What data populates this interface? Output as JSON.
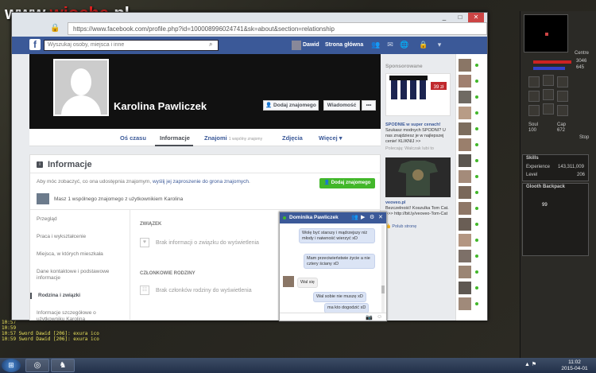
{
  "watermark": {
    "prefix": "www.",
    "brand": "wiocha",
    "suffix": ".pl"
  },
  "game": {
    "chat_log": [
      "10:57",
      "10:59",
      "10:57 Sword Dawid [206]: exura ico",
      "10:59 Sword Dawid [206]: exura ico"
    ],
    "panel": {
      "centre_label": "Centre",
      "hp": "3046",
      "mana": "645",
      "soul_label": "Soul",
      "soul_value": "100",
      "cap_label": "Cap",
      "cap_value": "672",
      "stop_label": "Stop",
      "skills_title": "Skills",
      "experience_label": "Experience",
      "experience_value": "143,311,009",
      "level_label": "Level",
      "level_value": "206",
      "backpack_title": "Glooth Backpack",
      "backpack_count": "99"
    }
  },
  "browser": {
    "url": "https://www.facebook.com/profile.php?id=100008996024741&sk=about&section=relationship"
  },
  "fb": {
    "search_placeholder": "Wyszukaj osoby, miejsca i inne",
    "user_name": "Dawid",
    "home_label": "Strona główna",
    "profile_name": "Karolina Pawliczek",
    "add_friend": "Dodaj znajomego",
    "message": "Wiadomość",
    "more": "•••",
    "tabs": {
      "timeline": "Oś czasu",
      "about": "Informacje",
      "friends": "Znajomi",
      "friends_sub": "1 wspólny znajomy",
      "photos": "Zdjęcia",
      "more": "Więcej"
    },
    "about": {
      "title": "Informacje",
      "invite_pre": "Aby móc zobaczyć, co ona udostępnia znajomym,",
      "invite_link": "wyślij jej zaproszenie do grona znajomych",
      "invite_post": ".",
      "add_btn": "Dodaj znajomego",
      "mutual": "Masz 1 wspólnego znajomego z użytkownikiem Karolina",
      "menu": [
        "Przegląd",
        "Praca i wykształcenie",
        "Miejsca, w których mieszkała",
        "Dane kontaktowe i podstawowe informacje",
        "Rodzina i związki",
        "Informacje szczegółowe o użytkowniku Karolina"
      ],
      "section1_title": "ZWIĄZEK",
      "section1_text": "Brak informacji o związku do wyświetlenia",
      "section2_title": "CZŁONKOWIE RODZINY",
      "section2_text": "Brak członków rodziny do wyświetlenia"
    },
    "sponsored": {
      "title": "Sponsorowane",
      "ad1_price": "39 zł",
      "ad1_head": "SPODNIE w super cenach!",
      "ad1_body": "Szukasz modnych SPODNI? U nas znajdziesz je w najlepszej cenie! KLIKNIJ >>",
      "ad1_sub": "Polecają: Walczak lubi to",
      "ad2_domain": "veoveo.pl",
      "ad2_body": "Bezczelność! Koszulka Tom Cat. >>> http://bit.ly/veoveo-Tom-Cat",
      "ad2_like": "Polub stronę"
    },
    "chat": {
      "name": "Dominika Pawliczek",
      "messages": [
        {
          "dir": "out",
          "text": "Wolę być starszy i mądrzejszy niż młody i naiwność wierzyć xD"
        },
        {
          "dir": "out",
          "text": "Mam przeciwieństwie życie a nie cztery ściany xD"
        },
        {
          "dir": "in",
          "text": "Wal się"
        },
        {
          "dir": "out",
          "text": "Wal sobie nie muszę xD"
        },
        {
          "dir": "out",
          "text": "ma kto dogodzić xD"
        }
      ]
    }
  },
  "taskbar": {
    "time": "11:02",
    "date": "2015-04-01"
  }
}
